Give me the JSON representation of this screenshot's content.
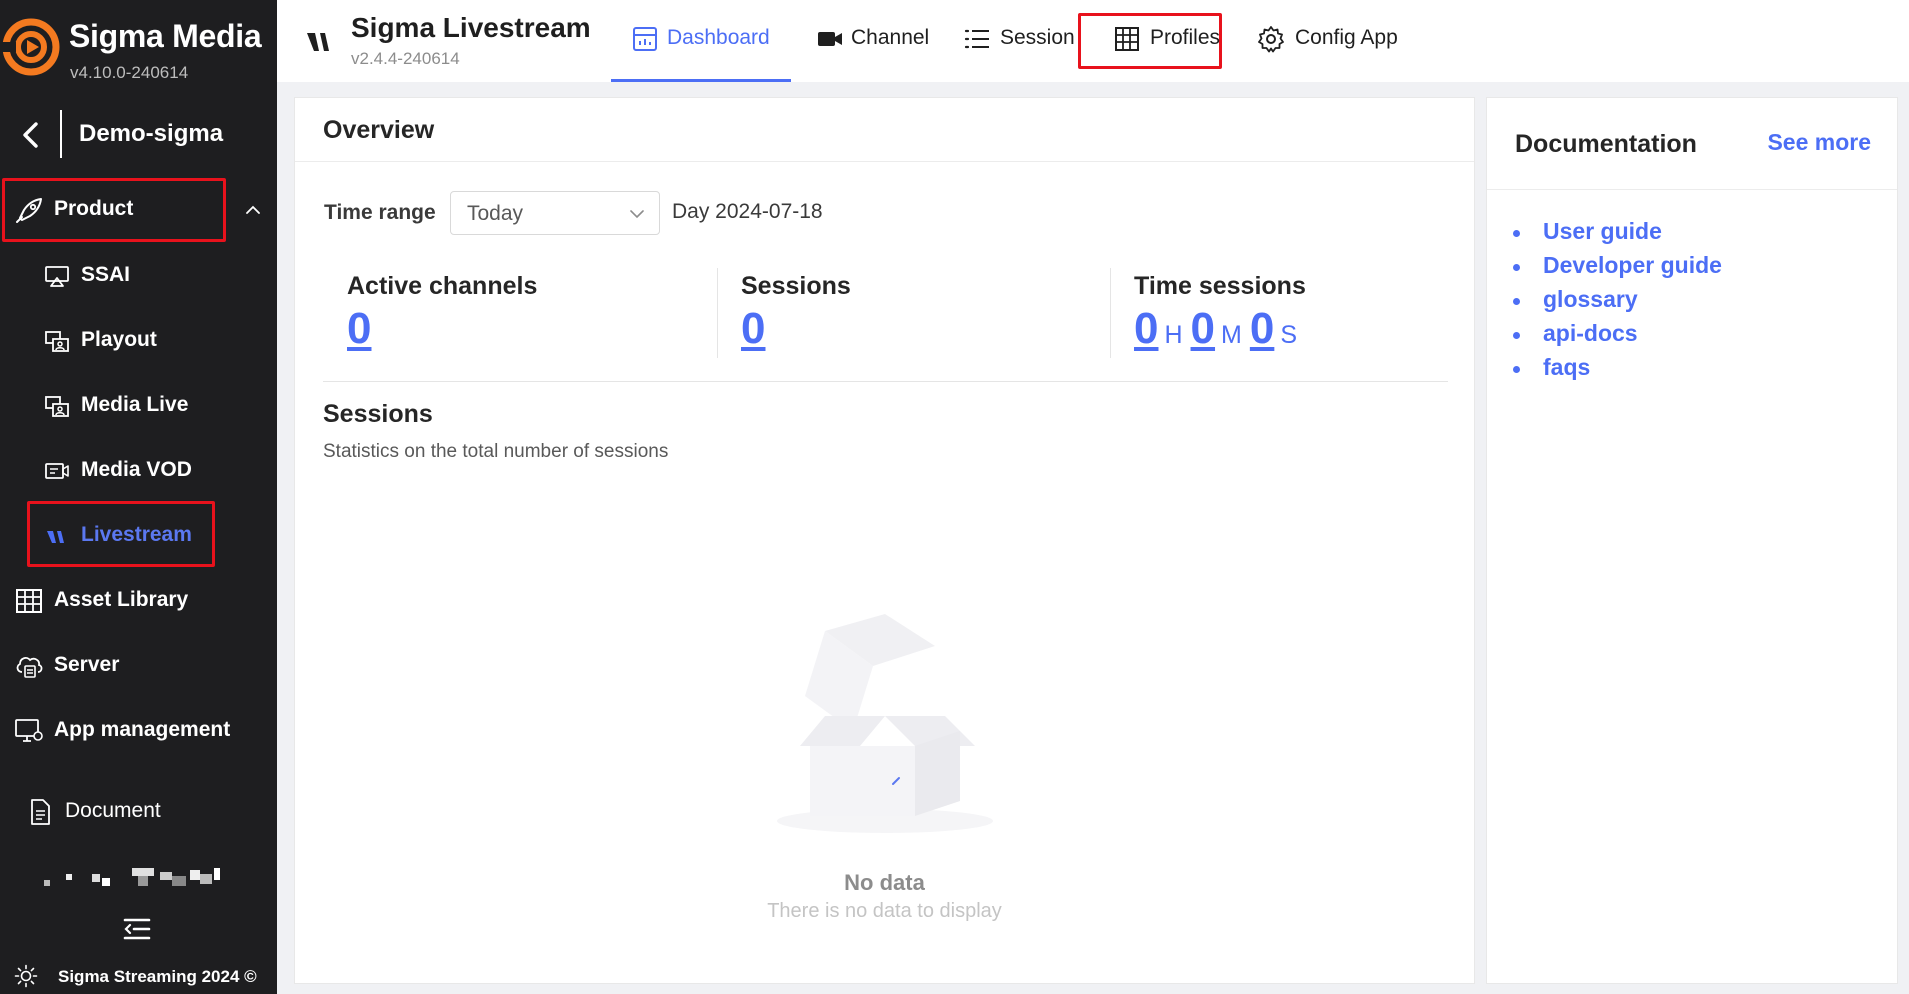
{
  "brand": {
    "name": "Sigma Media",
    "version": "v4.10.0-240614",
    "accent": "#f47a20"
  },
  "sidebar": {
    "back_title": "Demo-sigma",
    "product": {
      "label": "Product",
      "icon": "rocket-icon"
    },
    "sub_items": [
      {
        "label": "SSAI",
        "icon": "airplay-icon"
      },
      {
        "label": "Playout",
        "icon": "playout-icon"
      },
      {
        "label": "Media Live",
        "icon": "media-live-icon"
      },
      {
        "label": "Media VOD",
        "icon": "video-file-icon"
      },
      {
        "label": "Livestream",
        "icon": "livestream-icon",
        "active": true
      }
    ],
    "items": [
      {
        "label": "Asset Library",
        "icon": "grid-icon"
      },
      {
        "label": "Server",
        "icon": "cloud-server-icon"
      },
      {
        "label": "App management",
        "icon": "monitor-settings-icon"
      },
      {
        "label": "Document",
        "icon": "document-icon"
      }
    ],
    "footer": "Sigma Streaming 2024 ©"
  },
  "app": {
    "title": "Sigma Livestream",
    "version": "v2.4.4-240614"
  },
  "tabs": [
    {
      "label": "Dashboard",
      "icon": "dashboard-icon",
      "active": true
    },
    {
      "label": "Channel",
      "icon": "video-camera-icon"
    },
    {
      "label": "Session",
      "icon": "list-icon"
    },
    {
      "label": "Profiles",
      "icon": "table-icon"
    },
    {
      "label": "Config App",
      "icon": "gear-icon"
    }
  ],
  "overview": {
    "title": "Overview",
    "time_range_label": "Time range",
    "time_range_value": "Today",
    "day_text": "Day 2024-07-18",
    "stats": {
      "active_channels": {
        "label": "Active channels",
        "value": "0"
      },
      "sessions": {
        "label": "Sessions",
        "value": "0"
      },
      "time_sessions": {
        "label": "Time sessions",
        "hours": "0",
        "h_unit": "H",
        "minutes": "0",
        "m_unit": "M",
        "seconds": "0",
        "s_unit": "S"
      }
    },
    "sessions_section": {
      "title": "Sessions",
      "subtitle": "Statistics on the total number of sessions",
      "empty_title": "No data",
      "empty_desc": "There is no data to display"
    }
  },
  "documentation": {
    "title": "Documentation",
    "see_more": "See more",
    "links": [
      "User guide",
      "Developer guide",
      "glossary",
      "api-docs",
      "faqs"
    ]
  },
  "colors": {
    "primary": "#4c6ef5",
    "sidebar_bg": "#1e1e20",
    "highlight_box": "#e8121c"
  }
}
